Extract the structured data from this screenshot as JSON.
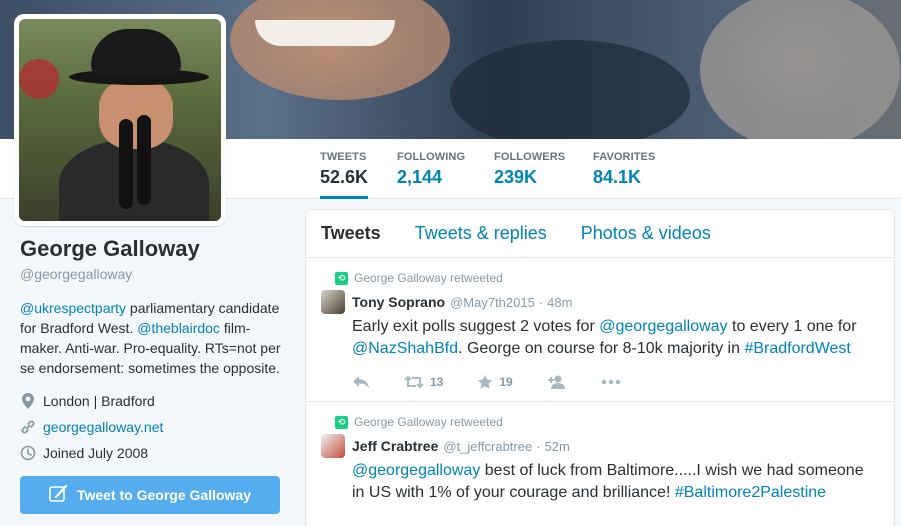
{
  "profile": {
    "name": "George Galloway",
    "handle": "@georgegalloway",
    "bio_parts": {
      "link1": "@ukrespectparty",
      "text1": " parliamentary candidate for Bradford West. ",
      "link2": "@theblairdoc",
      "text2": " film-maker. Anti-war. Pro-equality. RTs=not per se endorsement: sometimes the opposite."
    },
    "location": "London | Bradford",
    "website": "georgegalloway.net",
    "joined": "Joined July 2008",
    "tweet_to_button": "Tweet to George Galloway"
  },
  "stats": [
    {
      "label": "TWEETS",
      "value": "52.6K"
    },
    {
      "label": "FOLLOWING",
      "value": "2,144"
    },
    {
      "label": "FOLLOWERS",
      "value": "239K"
    },
    {
      "label": "FAVORITES",
      "value": "84.1K"
    }
  ],
  "timeline": {
    "tabs": [
      "Tweets",
      "Tweets & replies",
      "Photos & videos"
    ],
    "tweets": [
      {
        "retweeted_by": "George Galloway retweeted",
        "name": "Tony Soprano",
        "handle": "@May7th2015",
        "time": "48m",
        "text": {
          "t1": "Early exit polls suggest 2 votes for ",
          "l1": "@georgegalloway",
          "t2": " to every 1 one for ",
          "l2": "@NazShahBfd",
          "t3": ". George on course for 8-10k majority in ",
          "l3": "#BradfordWest"
        },
        "retweets": "13",
        "favorites": "19"
      },
      {
        "retweeted_by": "George Galloway retweeted",
        "name": "Jeff Crabtree",
        "handle": "@t_jeffcrabtree",
        "time": "52m",
        "text": {
          "l1": "@georgegalloway",
          "t1": " best of luck from Baltimore.....I wish we had someone in US with 1% of your courage and brilliance! ",
          "l2": "#Baltimore2Palestine"
        }
      }
    ]
  },
  "colors": {
    "accent": "#0084b4",
    "button": "#55acee",
    "retweet": "#19cf86"
  }
}
